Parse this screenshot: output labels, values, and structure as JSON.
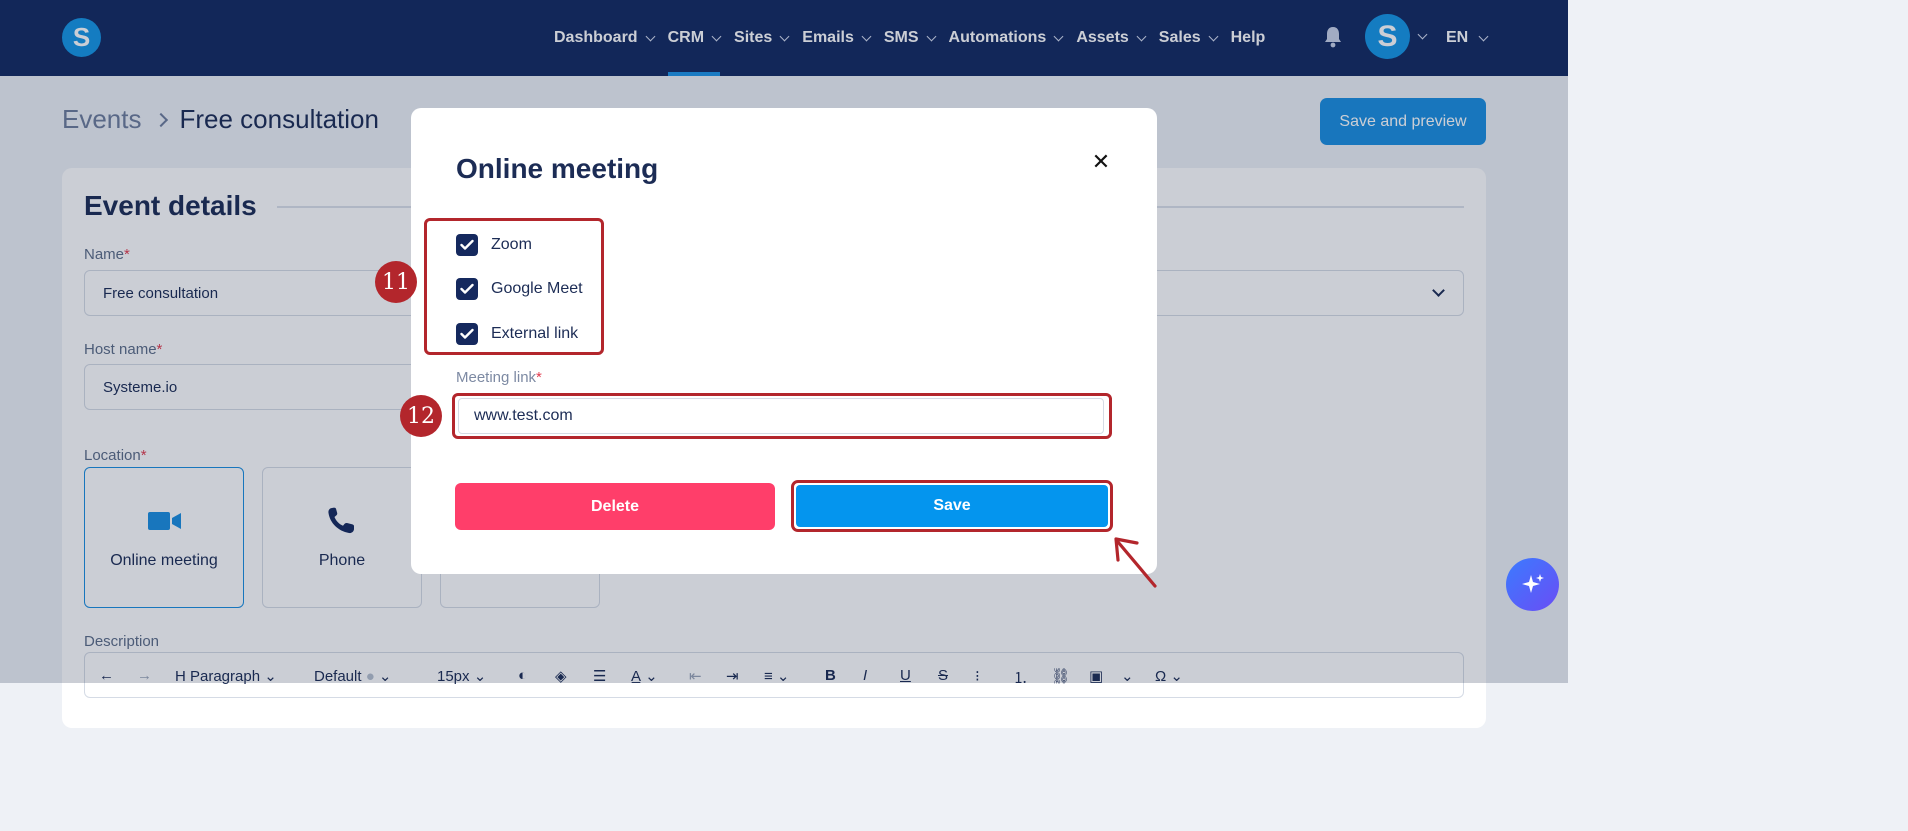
{
  "topbar": {
    "logo_letter": "S",
    "nav": [
      {
        "label": "Dashboard",
        "has_menu": true
      },
      {
        "label": "CRM",
        "has_menu": true,
        "active": true
      },
      {
        "label": "Sites",
        "has_menu": true
      },
      {
        "label": "Emails",
        "has_menu": true
      },
      {
        "label": "SMS",
        "has_menu": true
      },
      {
        "label": "Automations",
        "has_menu": true
      },
      {
        "label": "Assets",
        "has_menu": true
      },
      {
        "label": "Sales",
        "has_menu": true
      },
      {
        "label": "Help",
        "has_menu": false
      }
    ],
    "avatar_letter": "S",
    "language": "EN",
    "icons": {
      "notifications": "bell-icon"
    }
  },
  "page": {
    "breadcrumb": {
      "parent": "Events",
      "current": "Free consultation"
    },
    "save_preview_label": "Save and preview",
    "card_title": "Event details",
    "name_label": "Name",
    "name_value": "Free consultation",
    "host_label": "Host name",
    "host_value": "Systeme.io",
    "location_label": "Location",
    "location_options": [
      {
        "label": "Online meeting",
        "icon": "video-camera-icon",
        "selected": true
      },
      {
        "label": "Phone",
        "icon": "phone-icon",
        "selected": false
      }
    ],
    "description_label": "Description",
    "toolbar": {
      "block_style": "Paragraph",
      "font": "Default",
      "font_size": "15px"
    },
    "required_mark": "*"
  },
  "modal": {
    "title": "Online meeting",
    "checkboxes": [
      {
        "label": "Zoom",
        "checked": true
      },
      {
        "label": "Google Meet",
        "checked": true
      },
      {
        "label": "External link",
        "checked": true
      }
    ],
    "meeting_link_label": "Meeting link",
    "meeting_link_value": "www.test.com",
    "delete_label": "Delete",
    "save_label": "Save"
  },
  "annotations": {
    "step_11": "11",
    "step_12": "12"
  },
  "colors": {
    "nav_bg": "#132a61",
    "accent": "#1a8fe0",
    "delete": "#ff3e6a",
    "annotation": "#b3262c"
  }
}
